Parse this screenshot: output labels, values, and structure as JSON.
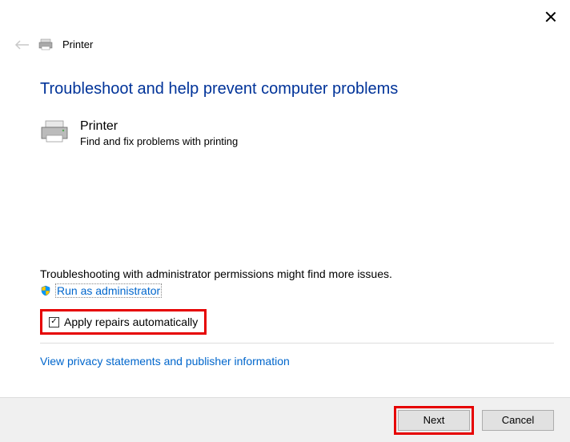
{
  "header": {
    "title": "Printer"
  },
  "main": {
    "heading": "Troubleshoot and help prevent computer problems",
    "troubleshooter": {
      "name": "Printer",
      "description": "Find and fix problems with printing"
    },
    "admin_note": "Troubleshooting with administrator permissions might find more issues.",
    "admin_link": "Run as administrator",
    "checkbox_label": "Apply repairs automatically",
    "checkbox_checked": "✓",
    "privacy_link": "View privacy statements and publisher information"
  },
  "footer": {
    "next": "Next",
    "cancel": "Cancel"
  }
}
